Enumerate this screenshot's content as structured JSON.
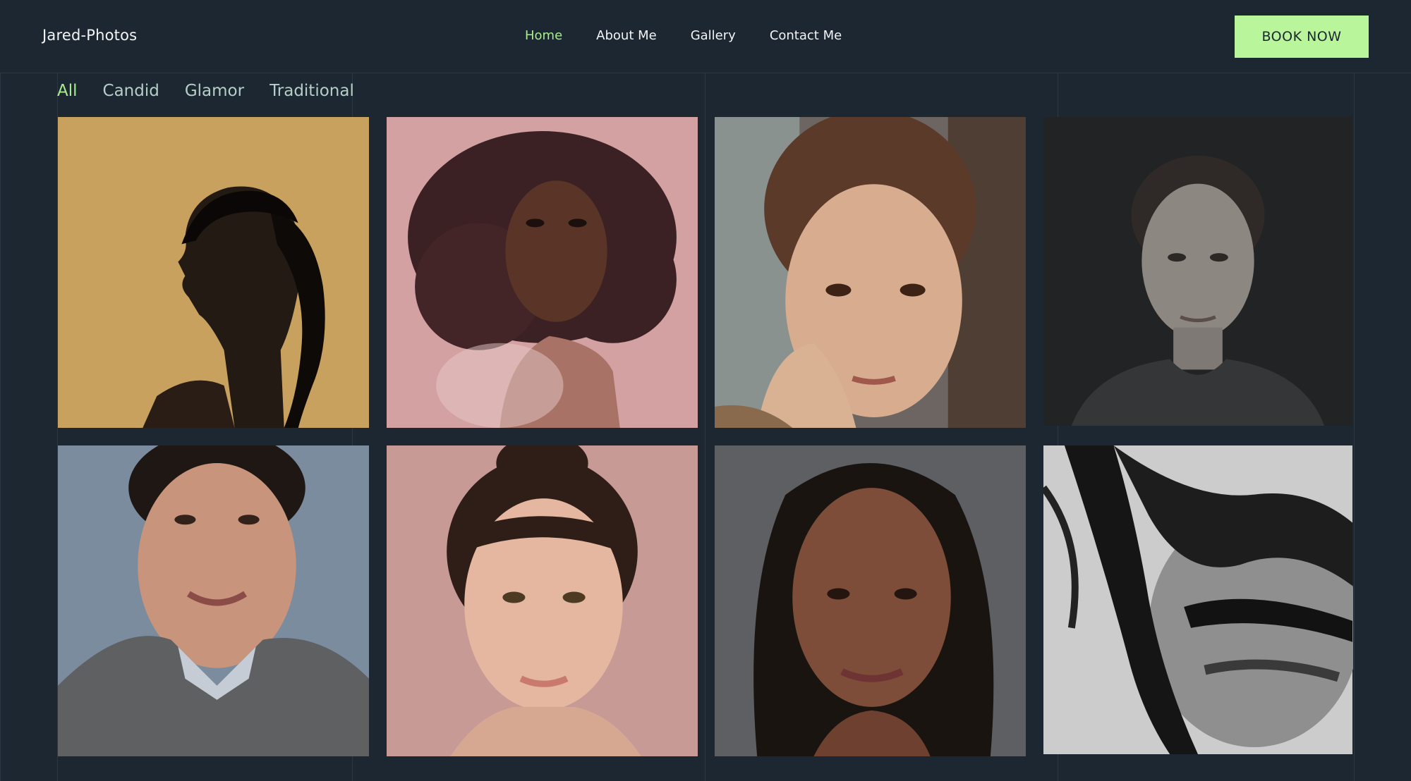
{
  "header": {
    "logo": "Jared-Photos",
    "nav": [
      {
        "label": "Home",
        "active": true
      },
      {
        "label": "About Me",
        "active": false
      },
      {
        "label": "Gallery",
        "active": false
      },
      {
        "label": "Contact Me",
        "active": false
      }
    ],
    "cta_label": "BOOK NOW"
  },
  "filters": [
    {
      "label": "All",
      "active": true
    },
    {
      "label": "Candid",
      "active": false
    },
    {
      "label": "Glamor",
      "active": false
    },
    {
      "label": "Traditional",
      "active": false
    }
  ],
  "gallery": [
    {
      "subject": "profile portrait, woman with long braid",
      "background": "#c9a15e"
    },
    {
      "subject": "woman with curly afro hair",
      "background": "#d4a1a3"
    },
    {
      "subject": "freckled woman, hand on cheek",
      "background": "#6c6561"
    },
    {
      "subject": "short-haired woman, monochrome",
      "background": "#222324"
    },
    {
      "subject": "smiling man in grey sweater",
      "background": "#7a8c9e"
    },
    {
      "subject": "woman with hair in a bun",
      "background": "#c79a96"
    },
    {
      "subject": "woman with long dark hair",
      "background": "#5e5f63"
    },
    {
      "subject": "windswept hair, black and white",
      "background": "#bcbcbc"
    }
  ],
  "colors": {
    "page_bg": "#1c2732",
    "accent": "#a8ec8c",
    "cta_bg": "#b9f59b",
    "filter_text": "#b5cec6",
    "guide_line": "#2c3944"
  }
}
